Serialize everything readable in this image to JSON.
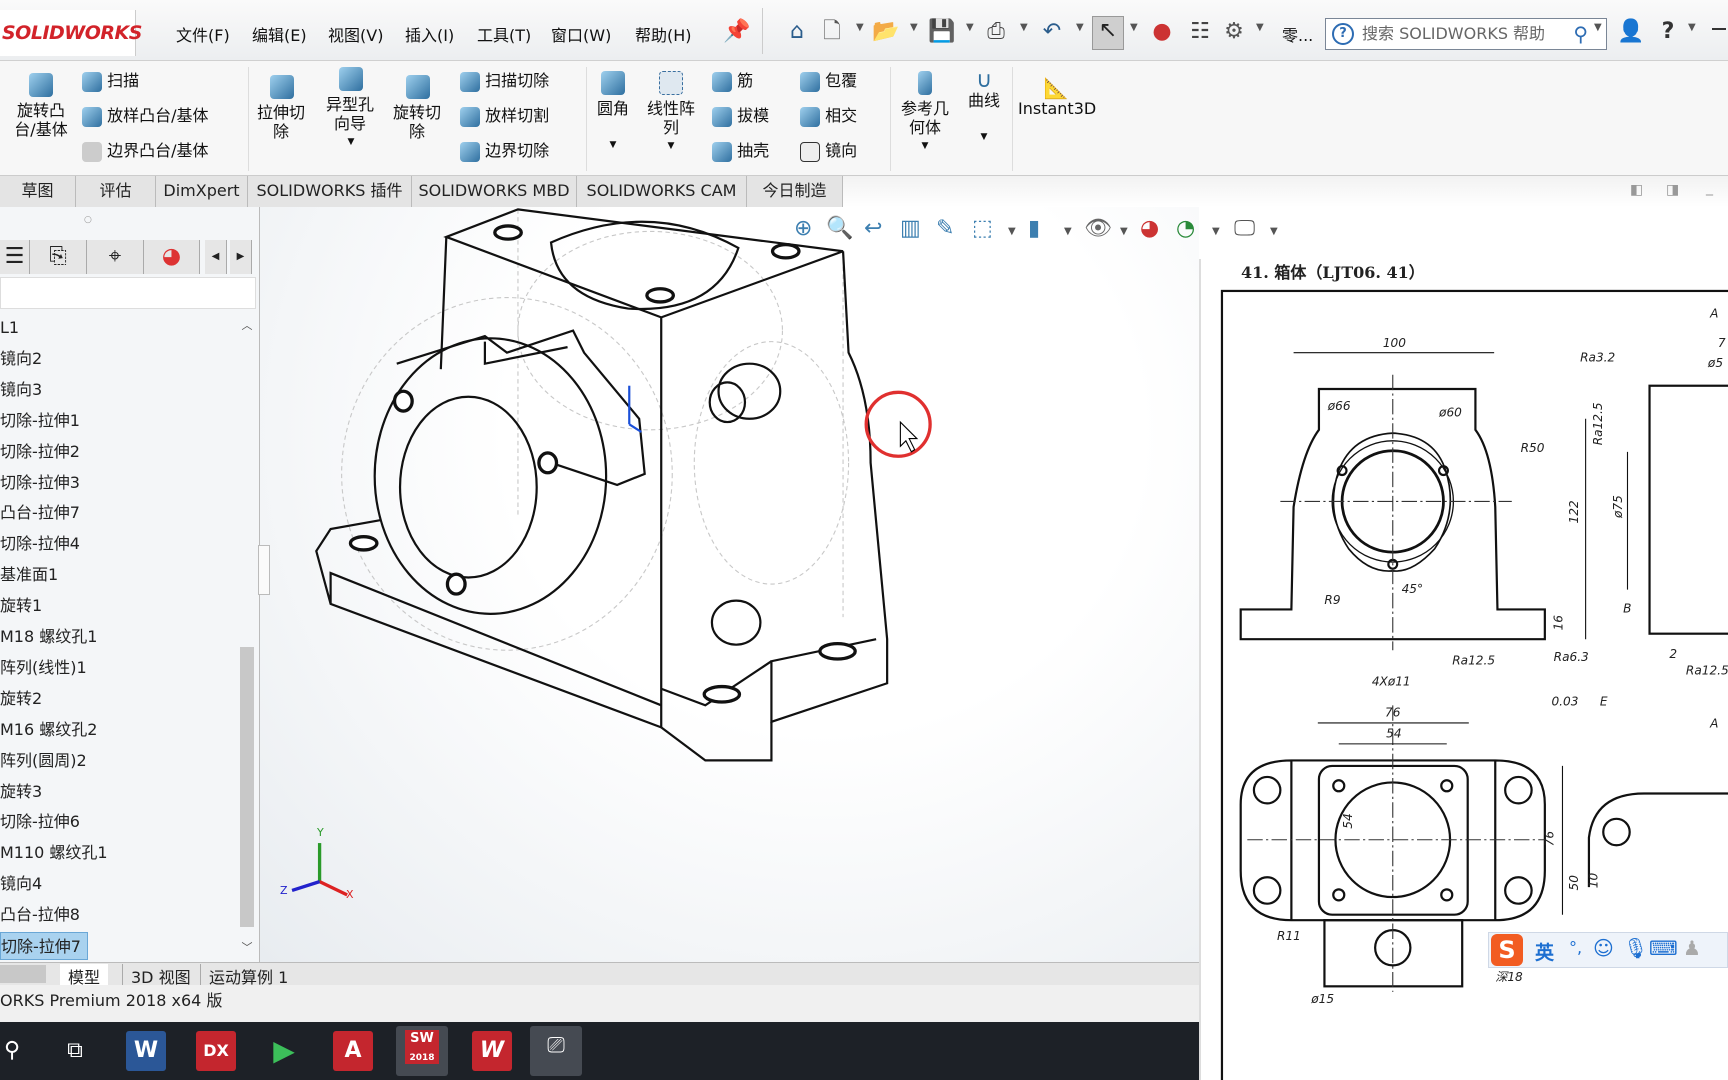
{
  "app": {
    "logo": "SOLIDWORKS"
  },
  "menu": [
    "文件(F)",
    "编辑(E)",
    "视图(V)",
    "插入(I)",
    "工具(T)",
    "窗口(W)",
    "帮助(H)"
  ],
  "search": {
    "placeholder": "搜索 SOLIDWORKS 帮助"
  },
  "toolbar_extra": "零...",
  "ribbon": {
    "revolve_boss": "旋转凸台/基体",
    "sweep": "扫描",
    "loft_boss": "放样凸台/基体",
    "boundary_boss": "边界凸台/基体",
    "extruded_cut": "拉伸切除",
    "hole_wizard": "异型孔向导",
    "revolved_cut": "旋转切除",
    "swept_cut": "扫描切除",
    "lofted_cut": "放样切割",
    "boundary_cut": "边界切除",
    "fillet": "圆角",
    "linear_pattern": "线性阵列",
    "rib": "筋",
    "draft": "拔模",
    "shell": "抽壳",
    "wrap": "包覆",
    "intersect": "相交",
    "mirror": "镜向",
    "ref_geometry": "参考几何体",
    "curves": "曲线",
    "instant3d": "Instant3D"
  },
  "tabs": [
    "草图",
    "评估",
    "DimXpert",
    "SOLIDWORKS 插件",
    "SOLIDWORKS MBD",
    "SOLIDWORKS CAM",
    "今日制造"
  ],
  "tree": [
    "L1",
    "镜向2",
    "镜向3",
    "切除-拉伸1",
    "切除-拉伸2",
    "切除-拉伸3",
    "凸台-拉伸7",
    "切除-拉伸4",
    "基准面1",
    "旋转1",
    "M18 螺纹孔1",
    "阵列(线性)1",
    "旋转2",
    "M16 螺纹孔2",
    "阵列(圆周)2",
    "旋转3",
    "切除-拉伸6",
    "M110 螺纹孔1",
    "镜向4",
    "凸台-拉伸8",
    "切除-拉伸7"
  ],
  "tree_selected_index": 20,
  "bottom_tabs": [
    "模型",
    "3D 视图",
    "运动算例 1"
  ],
  "status": "ORKS Premium 2018 x64 版",
  "triad": {
    "x": "X",
    "y": "Y",
    "z": "Z"
  },
  "taskbar": [
    "search",
    "task-view",
    "Word",
    "DX",
    "media-player",
    "Autodesk",
    "SW 2018",
    "WPS",
    "camera"
  ],
  "taskbar_labels": {
    "word": "W",
    "dx": "DX",
    "autocad": "A",
    "sw": "SW",
    "sw_year": "2018",
    "wps": "W"
  },
  "drawing": {
    "title": "41. 箱体（LJT06. 41）",
    "labels": [
      "100",
      "ø66",
      "ø60",
      "R50",
      "R9",
      "45°",
      "Ra3.2",
      "Ra12.5",
      "122",
      "ø75",
      "16",
      "B",
      "4Xø11",
      "Ra12.5",
      "Ra6.3",
      "0.03",
      "E",
      "2",
      "Ra12.5",
      "A",
      "A",
      "76",
      "54",
      "54",
      "76",
      "50",
      "10",
      "R11",
      "ø15",
      "7",
      "ø5",
      "深18"
    ]
  },
  "ime": {
    "logo": "S",
    "mode": "英",
    "punct": "°,"
  },
  "colors": {
    "logo": "#d2232a",
    "selection": "#a9d2ef",
    "cursor_ring": "#e0302f",
    "taskbar": "#1d2127"
  }
}
